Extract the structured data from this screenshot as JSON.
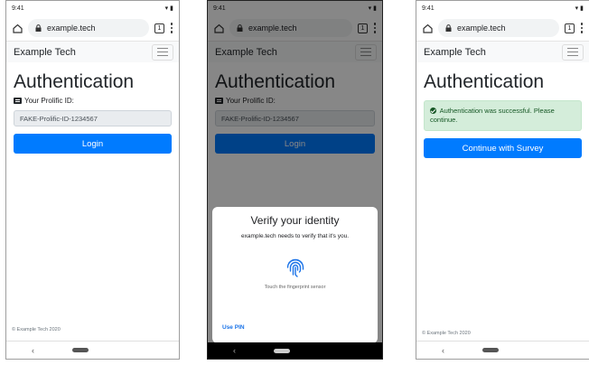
{
  "common": {
    "time": "9:41",
    "url": "example.tech",
    "tab_count": "1",
    "brand": "Example Tech",
    "footer": "© Example Tech 2020",
    "back_glyph": "‹"
  },
  "login": {
    "title": "Authentication",
    "id_label": "Your Prolific ID:",
    "id_value": "FAKE-Prolific-ID-1234567",
    "button": "Login"
  },
  "verify": {
    "title": "Verify your identity",
    "subtitle": "example.tech needs to verify that it's you.",
    "hint": "Touch the fingerprint sensor",
    "use_pin": "Use PIN"
  },
  "success": {
    "title": "Authentication",
    "alert": "Authentication was successful. Please continue.",
    "button": "Continue with Survey"
  },
  "icons": [
    "home-icon",
    "lock-icon",
    "tabs-icon",
    "menu-dots-icon",
    "hamburger-icon",
    "id-card-icon",
    "fingerprint-icon",
    "check-circle-icon",
    "wifi-icon",
    "battery-icon"
  ],
  "colors": {
    "primary": "#007bff",
    "success_bg": "#d4edda",
    "success_text": "#155724",
    "link": "#1a73e8",
    "fingerprint": "#1a73e8"
  }
}
